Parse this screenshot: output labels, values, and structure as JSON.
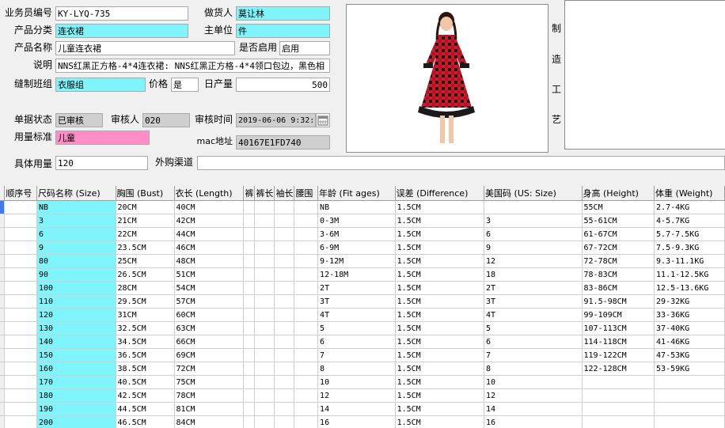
{
  "form": {
    "salesman_no_label": "业务员编号",
    "salesman_no_value": "KY-LYQ-735",
    "merchandiser_label": "做货人",
    "merchandiser_value": "莫让林",
    "category_label": "产品分类",
    "category_value": "连衣裙",
    "main_unit_label": "主单位",
    "main_unit_value": "件",
    "product_name_label": "产品名称",
    "product_name_value": "儿童连衣裙",
    "enabled_label": "是否启用",
    "enabled_value": "启用",
    "desc_label": "说明",
    "desc_value": "NNS红黑正方格-4*4连衣裙: NNS红黑正方格-4*4领口包边，黑色相",
    "sewing_group_label": "缝制班组",
    "sewing_group_value": "衣服组",
    "price_label": "价格",
    "price_value": "是",
    "daily_output_label": "日产量",
    "daily_output_value": "500",
    "doc_status_label": "单据状态",
    "doc_status_value": "已审核",
    "auditor_label": "审核人",
    "auditor_value": "020",
    "audit_time_label": "审核时间",
    "audit_time_value": "2019-06-06 9:32:",
    "usage_std_label": "用量标准",
    "usage_std_value": "儿童",
    "mac_label": "mac地址",
    "mac_value": "40167E1FD740",
    "specific_usage_label": "具体用量",
    "specific_usage_value": "120",
    "outsource_label": "外购渠道",
    "outsource_value": ""
  },
  "process_panel": {
    "chars": [
      "制",
      "造",
      "工",
      "艺"
    ]
  },
  "colors": {
    "cyan": "#7ff4fb",
    "pink": "#ff8ec6",
    "selection": "#3c7cf0"
  },
  "grid": {
    "headers": [
      "顺序号",
      "尺码名称 (Size)",
      "胸围 (Bust)",
      "衣长 (Length)",
      "裤",
      "裤长",
      "袖长",
      "腰围",
      "年龄 (Fit ages)",
      "误差 (Difference)",
      "美国码 (US: Size)",
      "身高 (Height)",
      "体重 (Weight)"
    ],
    "rows": [
      [
        "",
        "NB",
        "20CM",
        "40CM",
        "",
        "",
        "",
        "",
        "NB",
        "1.5CM",
        "",
        "55CM",
        "2.7-4KG"
      ],
      [
        "",
        "3",
        "21CM",
        "42CM",
        "",
        "",
        "",
        "",
        "0-3M",
        "1.5CM",
        "3",
        "55-61CM",
        "4-5.7KG"
      ],
      [
        "",
        "6",
        "22CM",
        "44CM",
        "",
        "",
        "",
        "",
        "3-6M",
        "1.5CM",
        "6",
        "61-67CM",
        "5.7-7.5KG"
      ],
      [
        "",
        "9",
        "23.5CM",
        "46CM",
        "",
        "",
        "",
        "",
        "6-9M",
        "1.5CM",
        "9",
        "67-72CM",
        "7.5-9.3KG"
      ],
      [
        "",
        "80",
        "25CM",
        "48CM",
        "",
        "",
        "",
        "",
        "9-12M",
        "1.5CM",
        "12",
        "72-78CM",
        "9.3-11.1KG"
      ],
      [
        "",
        "90",
        "26.5CM",
        "51CM",
        "",
        "",
        "",
        "",
        "12-18M",
        "1.5CM",
        "18",
        "78-83CM",
        "11.1-12.5KG"
      ],
      [
        "",
        "100",
        "28CM",
        "54CM",
        "",
        "",
        "",
        "",
        "2T",
        "1.5CM",
        "2T",
        "83-86CM",
        "12.5-13.6KG"
      ],
      [
        "",
        "110",
        "29.5CM",
        "57CM",
        "",
        "",
        "",
        "",
        "3T",
        "1.5CM",
        "3T",
        "91.5-98CM",
        "29-32KG"
      ],
      [
        "",
        "120",
        "31CM",
        "60CM",
        "",
        "",
        "",
        "",
        "4T",
        "1.5CM",
        "4T",
        "99-109CM",
        "33-36KG"
      ],
      [
        "",
        "130",
        "32.5CM",
        "63CM",
        "",
        "",
        "",
        "",
        "5",
        "1.5CM",
        "5",
        "107-113CM",
        "37-40KG"
      ],
      [
        "",
        "140",
        "34.5CM",
        "66CM",
        "",
        "",
        "",
        "",
        "6",
        "1.5CM",
        "6",
        "114-118CM",
        "41-46KG"
      ],
      [
        "",
        "150",
        "36.5CM",
        "69CM",
        "",
        "",
        "",
        "",
        "7",
        "1.5CM",
        "7",
        "119-122CM",
        "47-53KG"
      ],
      [
        "",
        "160",
        "38.5CM",
        "72CM",
        "",
        "",
        "",
        "",
        "8",
        "1.5CM",
        "8",
        "122-128CM",
        "53-59KG"
      ],
      [
        "",
        "170",
        "40.5CM",
        "75CM",
        "",
        "",
        "",
        "",
        "10",
        "1.5CM",
        "10",
        "",
        ""
      ],
      [
        "",
        "180",
        "42.5CM",
        "78CM",
        "",
        "",
        "",
        "",
        "12",
        "1.5CM",
        "12",
        "",
        ""
      ],
      [
        "",
        "190",
        "44.5CM",
        "81CM",
        "",
        "",
        "",
        "",
        "14",
        "1.5CM",
        "14",
        "",
        ""
      ],
      [
        "",
        "200",
        "46.5CM",
        "84CM",
        "",
        "",
        "",
        "",
        "16",
        "1.5CM",
        "16",
        "",
        ""
      ]
    ]
  }
}
